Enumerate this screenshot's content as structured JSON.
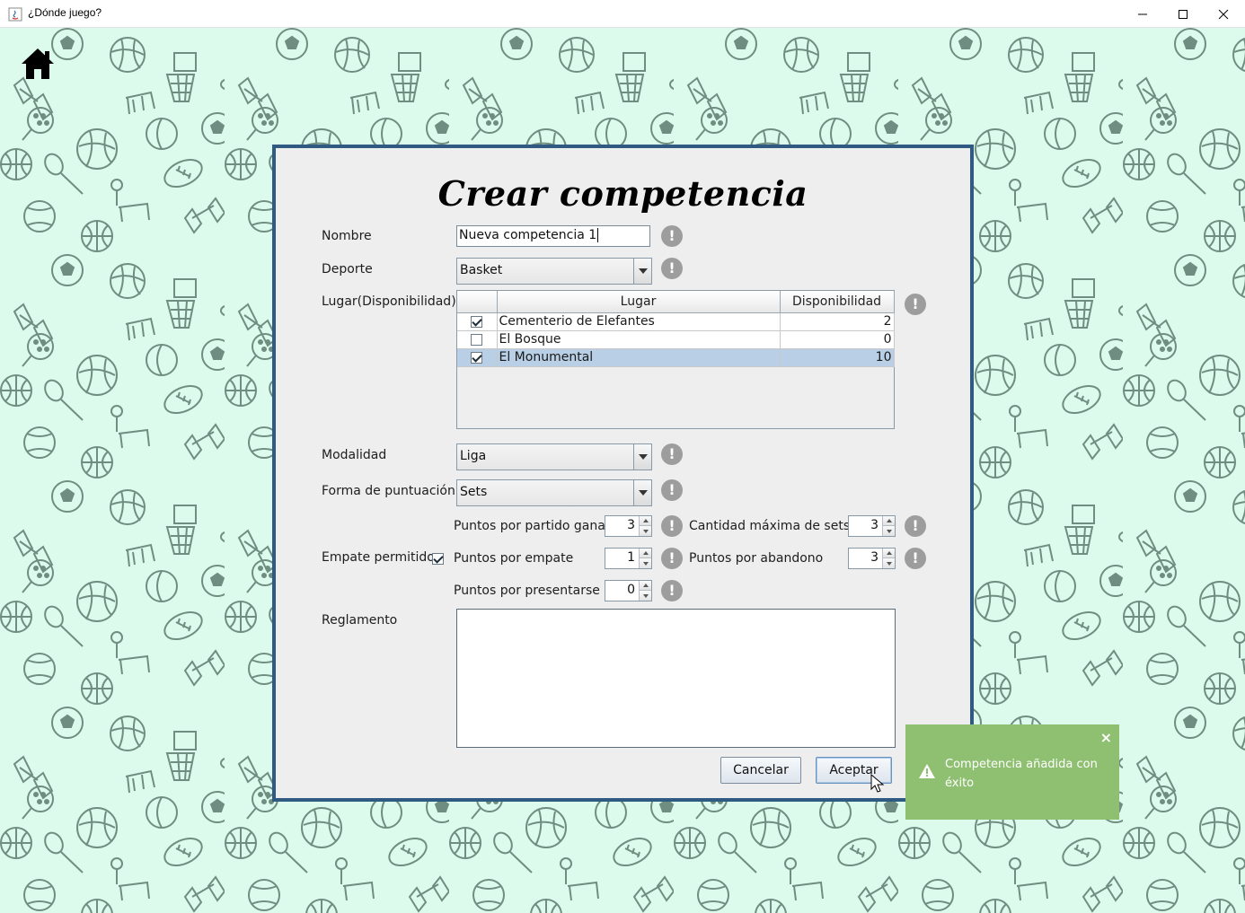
{
  "window": {
    "title": "¿Dónde juego?",
    "icon": "java-icon",
    "controls": [
      "minimize-icon",
      "maximize-icon",
      "close-icon"
    ]
  },
  "home": {
    "icon": "home-icon"
  },
  "dialog": {
    "title": "Crear competencia",
    "nombre": {
      "label": "Nombre",
      "value": "Nueva competencia 1"
    },
    "deporte": {
      "label": "Deporte",
      "value": "Basket"
    },
    "lugar": {
      "label": "Lugar(Disponibilidad)",
      "columns": [
        "",
        "Lugar",
        "Disponibilidad"
      ],
      "rows": [
        {
          "checked": true,
          "lugar": "Cementerio de Elefantes",
          "disponibilidad": "2",
          "selected": false
        },
        {
          "checked": false,
          "lugar": "El Bosque",
          "disponibilidad": "0",
          "selected": false
        },
        {
          "checked": true,
          "lugar": "El Monumental",
          "disponibilidad": "10",
          "selected": true
        }
      ]
    },
    "modalidad": {
      "label": "Modalidad",
      "value": "Liga"
    },
    "forma_puntuacion": {
      "label": "Forma de puntuación",
      "value": "Sets"
    },
    "puntos_partido_ganado": {
      "label": "Puntos por partido ganado",
      "value": "3"
    },
    "cantidad_maxima_sets": {
      "label": "Cantidad máxima de sets",
      "value": "3"
    },
    "empate_permitido": {
      "label": "Empate permitido",
      "checked": true
    },
    "puntos_empate": {
      "label": "Puntos por empate",
      "value": "1"
    },
    "puntos_abandono": {
      "label": "Puntos por abandono",
      "value": "3"
    },
    "puntos_presentarse": {
      "label": "Puntos por presentarse",
      "value": "0"
    },
    "reglamento": {
      "label": "Reglamento",
      "value": ""
    },
    "cancel_label": "Cancelar",
    "accept_label": "Aceptar"
  },
  "toast": {
    "message": "Competencia añadida con éxito",
    "icon": "warning-icon",
    "close": "×"
  },
  "colors": {
    "background": "#ddfbec",
    "pattern": "#6f8d80",
    "dialog_border": "#2f5a82",
    "toast": "#8fc072",
    "selected_row": "#b8cfe5"
  }
}
